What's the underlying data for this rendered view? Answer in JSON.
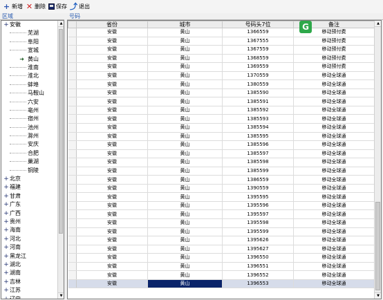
{
  "toolbar": {
    "add_label": "新增",
    "delete_label": "删除",
    "save_label": "保存",
    "exit_label": "退出"
  },
  "left_header": "区域",
  "right_header": "号码",
  "tree": {
    "root": "安徽",
    "children": [
      "芜湖",
      "阜阳",
      "宣城",
      "黄山",
      "淮南",
      "淮北",
      "蚌埠",
      "马鞍山",
      "六安",
      "亳州",
      "宿州",
      "池州",
      "滁州",
      "安庆",
      "合肥",
      "巢湖",
      "铜陵"
    ],
    "selected_child": "黄山",
    "provinces": [
      "北京",
      "福建",
      "甘肃",
      "广东",
      "广西",
      "贵州",
      "海南",
      "河北",
      "河南",
      "黑龙江",
      "湖北",
      "湖南",
      "吉林",
      "江苏",
      "辽宁",
      "内蒙古"
    ]
  },
  "grid": {
    "columns": [
      "省份",
      "城市",
      "号码头7位",
      "备注"
    ],
    "rows": [
      [
        "安徽",
        "黄山",
        "1366559",
        "移动预付费"
      ],
      [
        "安徽",
        "黄山",
        "1367555",
        "移动预付费"
      ],
      [
        "安徽",
        "黄山",
        "1367559",
        "移动预付费"
      ],
      [
        "安徽",
        "黄山",
        "1368559",
        "移动预付费"
      ],
      [
        "安徽",
        "黄山",
        "1369559",
        "移动预付费"
      ],
      [
        "安徽",
        "黄山",
        "1370559",
        "移动全球通"
      ],
      [
        "安徽",
        "黄山",
        "1380559",
        "移动全球通"
      ],
      [
        "安徽",
        "黄山",
        "1385590",
        "移动全球通"
      ],
      [
        "安徽",
        "黄山",
        "1385591",
        "移动全球通"
      ],
      [
        "安徽",
        "黄山",
        "1385592",
        "移动全球通"
      ],
      [
        "安徽",
        "黄山",
        "1385593",
        "移动全球通"
      ],
      [
        "安徽",
        "黄山",
        "1385594",
        "移动全球通"
      ],
      [
        "安徽",
        "黄山",
        "1385595",
        "移动全球通"
      ],
      [
        "安徽",
        "黄山",
        "1385596",
        "移动全球通"
      ],
      [
        "安徽",
        "黄山",
        "1385597",
        "移动全球通"
      ],
      [
        "安徽",
        "黄山",
        "1385598",
        "移动全球通"
      ],
      [
        "安徽",
        "黄山",
        "1385599",
        "移动全球通"
      ],
      [
        "安徽",
        "黄山",
        "1386559",
        "移动全球通"
      ],
      [
        "安徽",
        "黄山",
        "1390559",
        "移动全球通"
      ],
      [
        "安徽",
        "黄山",
        "1395595",
        "移动全球通"
      ],
      [
        "安徽",
        "黄山",
        "1395596",
        "移动全球通"
      ],
      [
        "安徽",
        "黄山",
        "1395597",
        "移动全球通"
      ],
      [
        "安徽",
        "黄山",
        "1395598",
        "移动全球通"
      ],
      [
        "安徽",
        "黄山",
        "1395599",
        "移动全球通"
      ],
      [
        "安徽",
        "黄山",
        "1395626",
        "移动全球通"
      ],
      [
        "安徽",
        "黄山",
        "1395627",
        "移动全球通"
      ],
      [
        "安徽",
        "黄山",
        "1396550",
        "移动全球通"
      ],
      [
        "安徽",
        "黄山",
        "1396551",
        "移动全球通"
      ],
      [
        "安徽",
        "黄山",
        "1396552",
        "移动全球通"
      ],
      [
        "安徽",
        "黄山",
        "1396553",
        "移动全球通"
      ]
    ],
    "selected_row": 29
  },
  "overlay_badge": "G"
}
